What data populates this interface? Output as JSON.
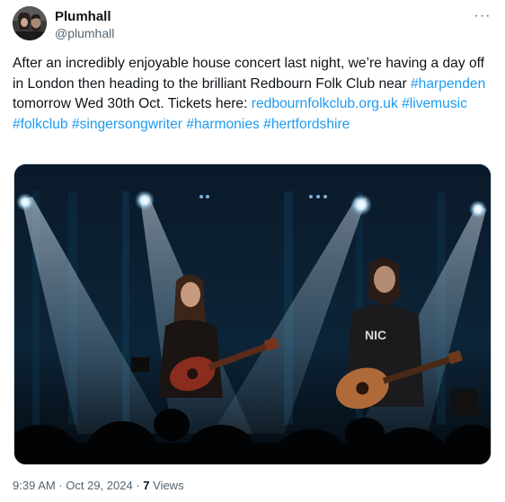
{
  "author": {
    "name": "Plumhall",
    "handle": "@plumhall",
    "avatar_icon": "avatar-photo"
  },
  "more_icon": "ellipsis-icon",
  "more_glyph": "···",
  "post": {
    "segments": [
      {
        "text": "After an incredibly enjoyable house concert last night, we’re having a day off in London then heading to the brilliant Redbourn Folk Club near ",
        "link": false
      },
      {
        "text": "#harpenden",
        "link": true
      },
      {
        "text": " tomorrow Wed 30th Oct. Tickets here: ",
        "link": false
      },
      {
        "text": "redbournfolkclub.org.uk",
        "link": true
      },
      {
        "text": " ",
        "link": false
      },
      {
        "text": "#livemusic",
        "link": true
      },
      {
        "text": " ",
        "link": false
      },
      {
        "text": "#folkclub",
        "link": true
      },
      {
        "text": " ",
        "link": false
      },
      {
        "text": "#singersongwriter",
        "link": true
      },
      {
        "text": " ",
        "link": false
      },
      {
        "text": "#harmonies",
        "link": true
      },
      {
        "text": " ",
        "link": false
      },
      {
        "text": "#hertfordshire",
        "link": true
      }
    ]
  },
  "media": {
    "description_icon": "concert-photo"
  },
  "meta": {
    "time": "9:39 AM",
    "sep": " · ",
    "date": "Oct 29, 2024",
    "sep2": " · ",
    "views_count": "7",
    "views_label": " Views"
  },
  "colors": {
    "link": "#1d9bf0",
    "text": "#0f1419",
    "secondary": "#536471"
  }
}
